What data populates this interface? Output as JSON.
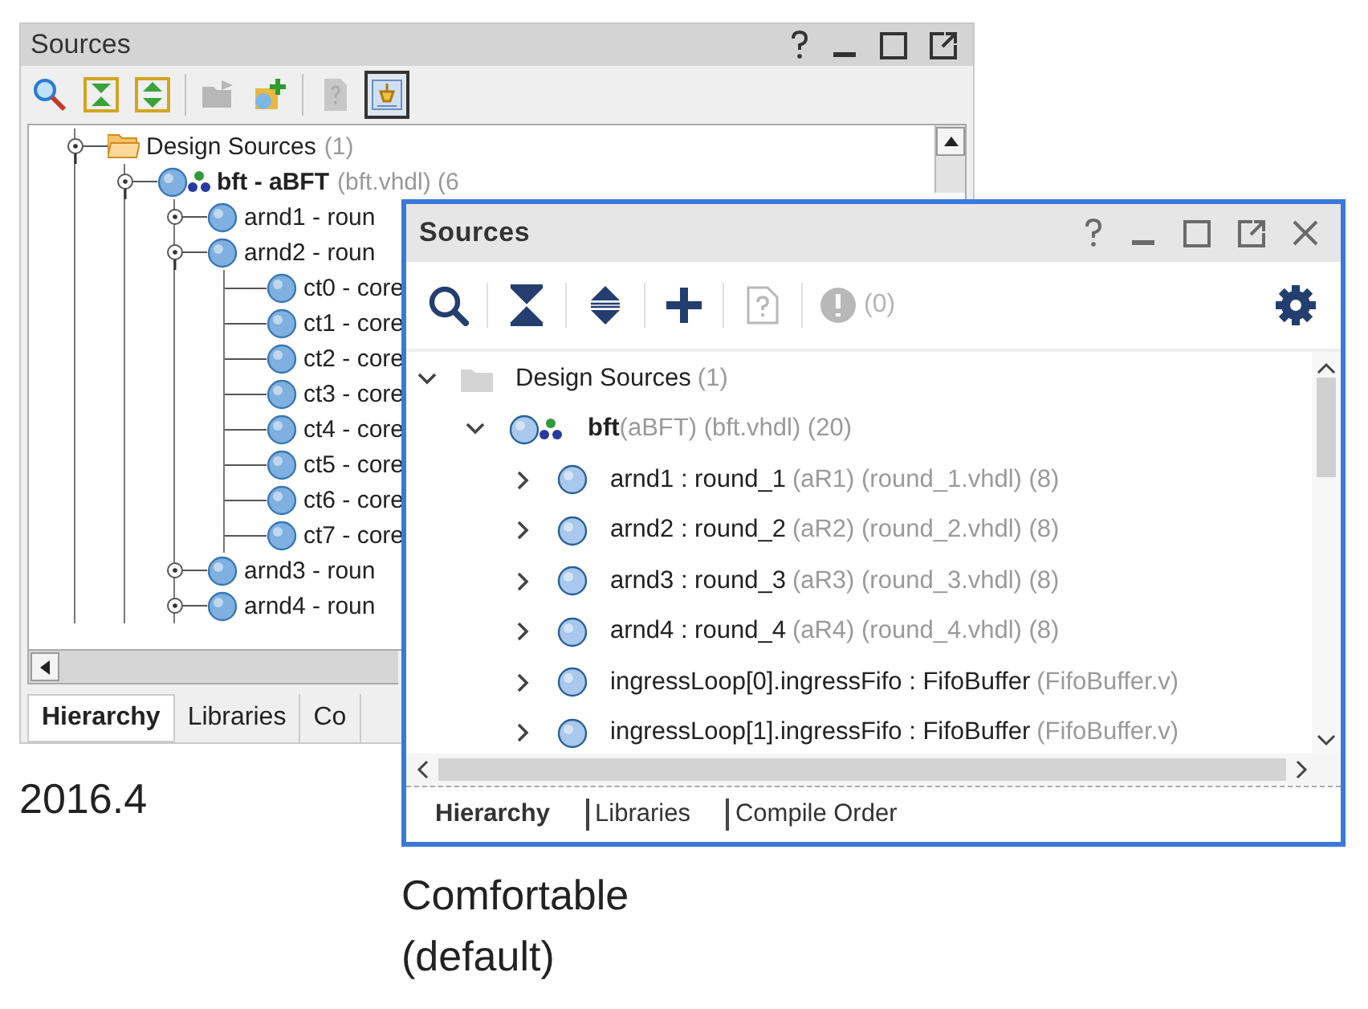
{
  "old_panel": {
    "title": "Sources",
    "controls": [
      {
        "kind": "help"
      },
      {
        "kind": "minimize"
      },
      {
        "kind": "maximize"
      },
      {
        "kind": "float"
      }
    ],
    "toolbar": [
      {
        "kind": "search",
        "selected": false,
        "disabled": false
      },
      {
        "kind": "collapse",
        "selected": false,
        "disabled": false
      },
      {
        "kind": "expand",
        "selected": false,
        "disabled": false
      },
      {
        "kind": "separator"
      },
      {
        "kind": "folder",
        "selected": false,
        "disabled": true
      },
      {
        "kind": "add",
        "selected": false,
        "disabled": false
      },
      {
        "kind": "separator"
      },
      {
        "kind": "document",
        "selected": false,
        "disabled": true
      },
      {
        "kind": "hierarchy",
        "selected": true,
        "disabled": false
      }
    ],
    "tree": [
      {
        "kind": "folder",
        "name": "Design Sources",
        "detail": "(1)",
        "expanded": true,
        "children": [
          {
            "kind": "top",
            "name": "bft - aBFT",
            "detail": "(bft.vhdl) (6",
            "expanded": true,
            "children": [
              {
                "kind": "module",
                "name": "arnd1 - roun",
                "expanded": false
              },
              {
                "kind": "module",
                "name": "arnd2 - roun",
                "expanded": true,
                "children": [
                  {
                    "kind": "module",
                    "name": "ct0 - core"
                  },
                  {
                    "kind": "module",
                    "name": "ct1 - core"
                  },
                  {
                    "kind": "module",
                    "name": "ct2 - core"
                  },
                  {
                    "kind": "module",
                    "name": "ct3 - core"
                  },
                  {
                    "kind": "module",
                    "name": "ct4 - core"
                  },
                  {
                    "kind": "module",
                    "name": "ct5 - core"
                  },
                  {
                    "kind": "module",
                    "name": "ct6 - core"
                  },
                  {
                    "kind": "module",
                    "name": "ct7 - core"
                  }
                ]
              },
              {
                "kind": "module",
                "name": "arnd3 - roun",
                "expanded": false
              },
              {
                "kind": "module",
                "name": "arnd4 - roun",
                "expanded": false
              }
            ]
          }
        ]
      }
    ],
    "tabs": [
      {
        "label": "Hierarchy",
        "selected": true
      },
      {
        "label": "Libraries",
        "selected": false
      },
      {
        "label": "Co",
        "selected": false
      }
    ],
    "caption": "2016.4"
  },
  "new_panel": {
    "title": "Sources",
    "controls": [
      {
        "kind": "help"
      },
      {
        "kind": "minimize"
      },
      {
        "kind": "maximize"
      },
      {
        "kind": "float"
      },
      {
        "kind": "close"
      }
    ],
    "toolbar": [
      {
        "kind": "search",
        "disabled": false
      },
      {
        "kind": "separator"
      },
      {
        "kind": "collapse",
        "disabled": false
      },
      {
        "kind": "separator"
      },
      {
        "kind": "expand",
        "disabled": false
      },
      {
        "kind": "separator"
      },
      {
        "kind": "add",
        "disabled": false
      },
      {
        "kind": "separator"
      },
      {
        "kind": "document",
        "disabled": true
      },
      {
        "kind": "separator"
      },
      {
        "kind": "alert",
        "disabled": true,
        "count": "(0)"
      },
      {
        "kind": "settings",
        "disabled": false
      }
    ],
    "tree": [
      {
        "kind": "folder",
        "name": "Design Sources",
        "detail": "(1)",
        "expanded": true,
        "children": [
          {
            "kind": "top",
            "name": "bft",
            "detail": "(aBFT) (bft.vhdl) (20)",
            "expanded": true,
            "children": [
              {
                "kind": "module",
                "name": "arnd1 : round_1",
                "detail": "(aR1) (round_1.vhdl) (8)",
                "expanded": false
              },
              {
                "kind": "module",
                "name": "arnd2 : round_2",
                "detail": "(aR2) (round_2.vhdl) (8)",
                "expanded": false
              },
              {
                "kind": "module",
                "name": "arnd3 : round_3",
                "detail": "(aR3) (round_3.vhdl) (8)",
                "expanded": false
              },
              {
                "kind": "module",
                "name": "arnd4 : round_4",
                "detail": "(aR4) (round_4.vhdl) (8)",
                "expanded": false
              },
              {
                "kind": "module",
                "name": "ingressLoop[0].ingressFifo : FifoBuffer",
                "detail": "(FifoBuffer.v)",
                "expanded": false
              },
              {
                "kind": "module",
                "name": "ingressLoop[1].ingressFifo : FifoBuffer",
                "detail": "(FifoBuffer.v)",
                "expanded": false
              }
            ]
          }
        ]
      }
    ],
    "tabs": [
      {
        "label": "Hierarchy",
        "selected": true
      },
      {
        "label": "Libraries",
        "selected": false
      },
      {
        "label": "Compile Order",
        "selected": false
      }
    ],
    "caption": "Comfortable (default)"
  }
}
